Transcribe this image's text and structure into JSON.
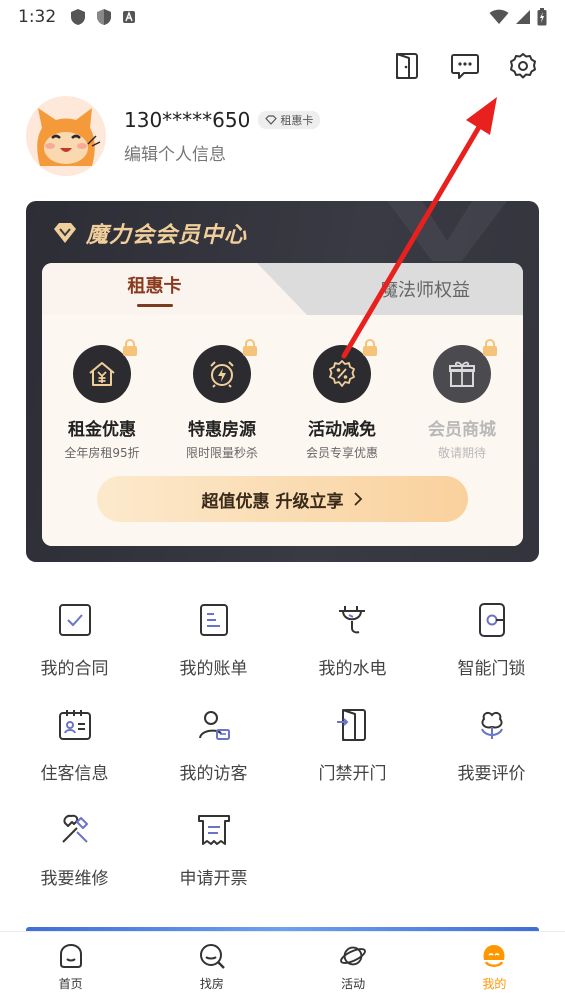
{
  "status_bar": {
    "time": "1:32"
  },
  "profile": {
    "phone": "130*****650",
    "badge": "租惠卡",
    "edit_label": "编辑个人信息"
  },
  "member_card": {
    "title": "魔力会会员中心",
    "tabs": [
      {
        "label": "租惠卡",
        "active": true
      },
      {
        "label": "魔法师权益",
        "active": false
      }
    ],
    "benefits": [
      {
        "name": "租金优惠",
        "desc": "全年房租95折",
        "icon": "rent-house-yuan-icon",
        "locked": true,
        "enabled": true
      },
      {
        "name": "特惠房源",
        "desc": "限时限量秒杀",
        "icon": "alarm-clock-flash-icon",
        "locked": true,
        "enabled": true
      },
      {
        "name": "活动减免",
        "desc": "会员专享优惠",
        "icon": "discount-badge-icon",
        "locked": true,
        "enabled": true
      },
      {
        "name": "会员商城",
        "desc": "敬请期待",
        "icon": "gift-box-icon",
        "locked": true,
        "enabled": false
      }
    ],
    "upgrade_label": "超值优惠 升级立享"
  },
  "services": [
    {
      "label": "我的合同",
      "icon": "contract-check-icon"
    },
    {
      "label": "我的账单",
      "icon": "bill-icon"
    },
    {
      "label": "我的水电",
      "icon": "utility-plug-icon"
    },
    {
      "label": "智能门锁",
      "icon": "smart-lock-icon"
    },
    {
      "label": "住客信息",
      "icon": "tenant-info-icon"
    },
    {
      "label": "我的访客",
      "icon": "visitor-icon"
    },
    {
      "label": "门禁开门",
      "icon": "door-access-icon"
    },
    {
      "label": "我要评价",
      "icon": "flower-review-icon"
    },
    {
      "label": "我要维修",
      "icon": "repair-tools-icon"
    },
    {
      "label": "申请开票",
      "icon": "invoice-icon"
    }
  ],
  "bottom_nav": [
    {
      "label": "首页",
      "icon": "home-icon",
      "active": false
    },
    {
      "label": "找房",
      "icon": "search-icon",
      "active": false
    },
    {
      "label": "活动",
      "icon": "planet-icon",
      "active": false
    },
    {
      "label": "我的",
      "icon": "mascot-icon",
      "active": true
    }
  ],
  "colors": {
    "accent": "#ff9700",
    "member_gold": "#f1cf9a",
    "annotation_arrow": "#e8211f"
  }
}
